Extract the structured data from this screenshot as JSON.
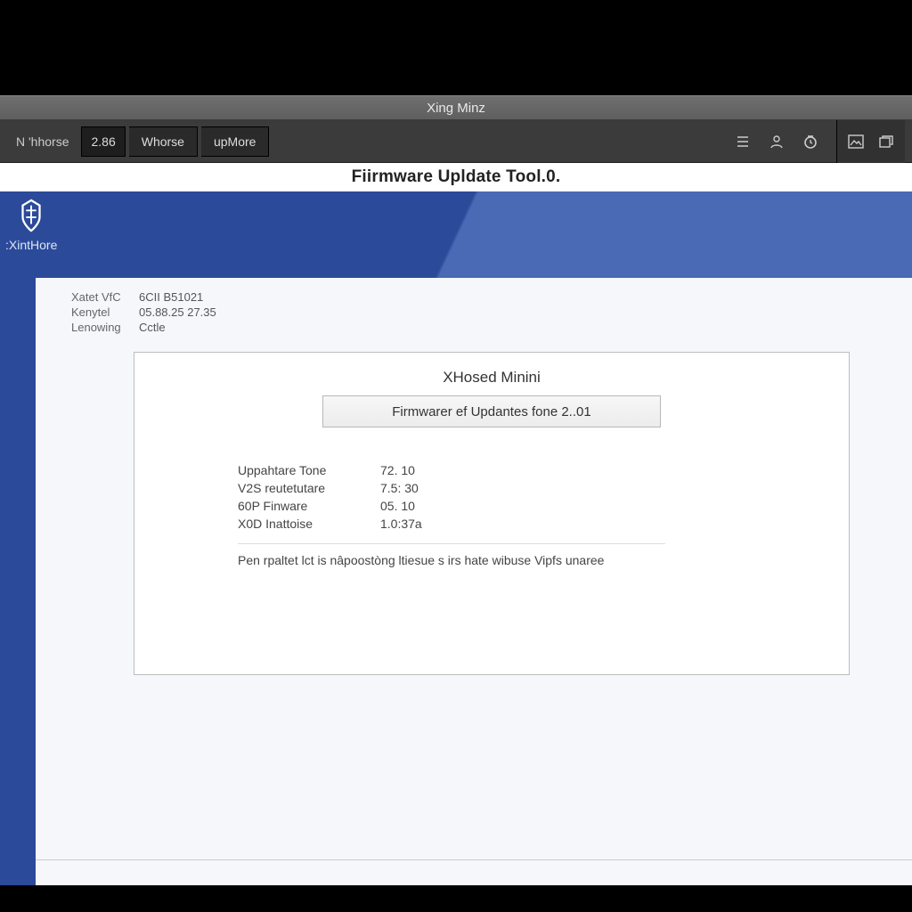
{
  "window": {
    "title": "Xing Minz"
  },
  "toolbar": {
    "logo_text": "N  'hhorse",
    "version": "2.86",
    "tab1": "Whorse",
    "tab2": "upMore"
  },
  "header": {
    "title": "Fiirmware Upldate Tool.0."
  },
  "brand": {
    "name": ":XintHore"
  },
  "device_info": {
    "rows": [
      {
        "k": "Xatet VfC",
        "v": "6CII B51021"
      },
      {
        "k": "Kenytel",
        "v": "05.88.25 27.35"
      },
      {
        "k": "Lenowing",
        "v": "Cctle"
      }
    ]
  },
  "panel": {
    "title": "XHosed Minini",
    "button_label": "Firmwarer ef Updantes fone 2..01",
    "versions": [
      {
        "k": "Uppahtare Tone",
        "v": "72. 10"
      },
      {
        "k": "V2S reutetutare",
        "v": "7.5: 30"
      },
      {
        "k": "60P Finware",
        "v": "05. 10"
      },
      {
        "k": "X0D Inattoise",
        "v": "1.0:37a"
      }
    ],
    "note": "Pen rpaltet lct is nâpoostòng ltiesue s irs hate wibuse Vipfs unaree"
  }
}
